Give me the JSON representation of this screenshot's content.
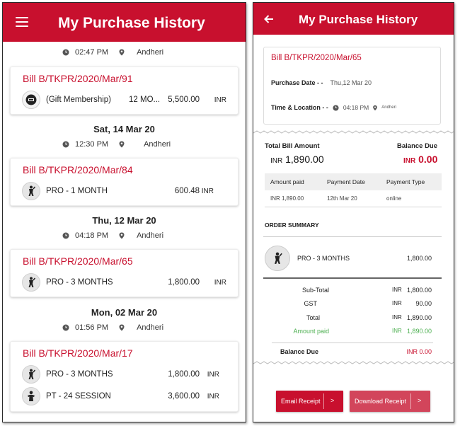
{
  "left": {
    "title": "My Purchase History",
    "top_time": "02:47 PM",
    "top_location": "Andheri",
    "groups": [
      {
        "bill": "Bill B/TKPR/2020/Mar/91",
        "items": [
          {
            "name": "(Gift Membership)",
            "duration": "12 MO...",
            "amount": "5,500.00",
            "currency": "INR",
            "icon": "gift-card-icon"
          }
        ]
      },
      {
        "date": "Sat, 14 Mar 20",
        "time": "12:30 PM",
        "location": "Andheri",
        "bill": "Bill B/TKPR/2020/Mar/84",
        "items": [
          {
            "name": "PRO - 1 MONTH",
            "amount": "600.48",
            "currency": "INR",
            "icon": "fitness-person-icon"
          }
        ]
      },
      {
        "date": "Thu, 12 Mar 20",
        "time": "04:18 PM",
        "location": "Andheri",
        "bill": "Bill B/TKPR/2020/Mar/65",
        "items": [
          {
            "name": "PRO - 3 MONTHS",
            "amount": "1,800.00",
            "currency": "INR",
            "icon": "fitness-person-icon"
          }
        ]
      },
      {
        "date": "Mon, 02 Mar 20",
        "time": "01:56 PM",
        "location": "Andheri",
        "bill": "Bill B/TKPR/2020/Mar/17",
        "items": [
          {
            "name": "PRO - 3 MONTHS",
            "amount": "1,800.00",
            "currency": "INR",
            "icon": "fitness-person-icon"
          },
          {
            "name": "PT - 24 SESSION",
            "amount": "3,600.00",
            "currency": "INR",
            "icon": "trainer-icon"
          }
        ]
      }
    ]
  },
  "right": {
    "title": "My Purchase History",
    "bill": "Bill B/TKPR/2020/Mar/65",
    "purchase_date_label": "Purchase Date - -",
    "purchase_date": "Thu,12 Mar 20",
    "time_location_label": "Time & Location - -",
    "time": "04:18 PM",
    "location": "Andheri",
    "total_label": "Total Bill Amount",
    "total_currency": "INR",
    "total_value": "1,890.00",
    "balance_label": "Balance Due",
    "balance_currency": "INR",
    "balance_value": "0.00",
    "payments": {
      "headers": [
        "Amount paid",
        "Payment Date",
        "Payment Type"
      ],
      "rows": [
        [
          "INR 1,890.00",
          "12th Mar 20",
          "online"
        ]
      ]
    },
    "order_summary_title": "ORDER SUMMARY",
    "order_item": {
      "name": "PRO - 3 MONTHS",
      "amount": "1,800.00"
    },
    "summary": [
      {
        "label": "Sub-Total",
        "currency": "INR",
        "value": "1,800.00"
      },
      {
        "label": "GST",
        "currency": "INR",
        "value": "90.00"
      },
      {
        "label": "Total",
        "currency": "INR",
        "value": "1,890.00"
      },
      {
        "label": "Amount paid",
        "currency": "INR",
        "value": "1,890.00"
      }
    ],
    "balance_due": {
      "label": "Balance Due",
      "value": "INR 0.00"
    },
    "buttons": {
      "email": "Email Receipt",
      "download": "Download Receipt",
      "chevron": ">"
    }
  },
  "colors": {
    "brand": "#c8102e",
    "paid_green": "#4caf50"
  }
}
